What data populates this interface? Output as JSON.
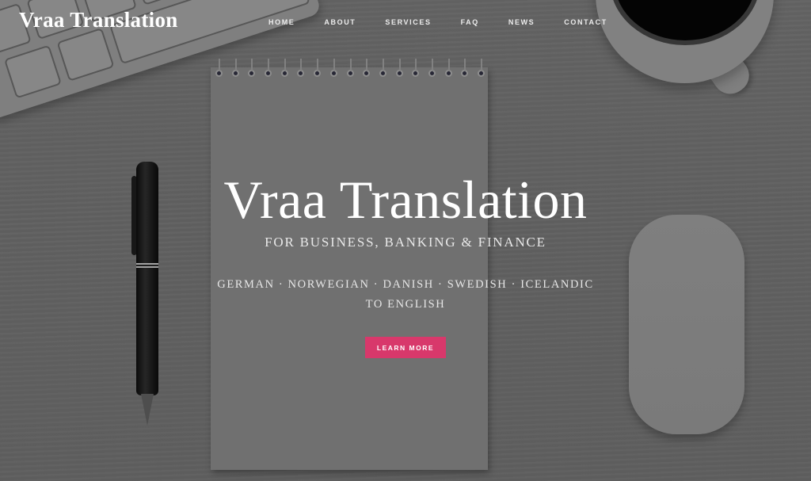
{
  "header": {
    "logo": "Vraa Translation",
    "nav": [
      {
        "label": "HOME"
      },
      {
        "label": "ABOUT"
      },
      {
        "label": "SERVICES"
      },
      {
        "label": "FAQ"
      },
      {
        "label": "NEWS"
      },
      {
        "label": "CONTACT"
      }
    ]
  },
  "hero": {
    "title": "Vraa Translation",
    "subtitle": "FOR BUSINESS, BANKING & FINANCE",
    "languages_line1": "GERMAN · NORWEGIAN · DANISH · SWEDISH · ICELANDIC",
    "languages_line2": "TO ENGLISH",
    "cta_label": "LEARN MORE"
  },
  "colors": {
    "accent": "#d8386b",
    "text": "#ffffff",
    "background": "#6a6a6a"
  },
  "background_image": {
    "description": "Grey wooden desk with keyboard, coffee cup, spiral notepad, pen and mouse",
    "objects": [
      "keyboard",
      "coffee-cup",
      "spiral-notepad",
      "pen",
      "mouse"
    ]
  }
}
